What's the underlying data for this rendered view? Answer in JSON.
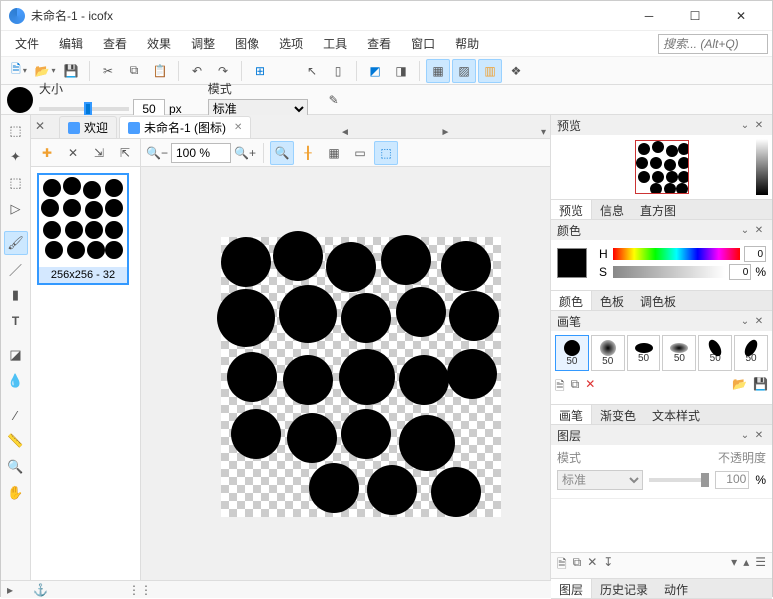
{
  "window": {
    "title": "未命名-1 - icofx"
  },
  "menu": {
    "file": "文件",
    "edit": "编辑",
    "view": "查看",
    "effect": "效果",
    "adjust": "调整",
    "image": "图像",
    "options": "选项",
    "tools": "工具",
    "view2": "查看",
    "window": "窗口",
    "help": "帮助",
    "searchPlaceholder": "搜索... (Alt+Q)"
  },
  "brushbar": {
    "sizeLabel": "大小",
    "sizeVal": "50",
    "sizeUnit": "px",
    "modeLabel": "模式",
    "modeVal": "标准"
  },
  "tabs": {
    "welcome": "欢迎",
    "doc": "未命名-1 (图标)"
  },
  "thumb": {
    "label": "256x256 - 32"
  },
  "canvas": {
    "zoom": "100 %"
  },
  "panels": {
    "preview": "预览",
    "previewTab": "预览",
    "infoTab": "信息",
    "histoTab": "直方图",
    "colors": "颜色",
    "colorsTab": "颜色",
    "paletteTab": "色板",
    "mixerTab": "调色板",
    "hVal": "0",
    "sVal": "0",
    "sUnit": "%",
    "hLab": "H",
    "sLab": "S",
    "brush": "画笔",
    "brushTab": "画笔",
    "gradTab": "渐变色",
    "textTab": "文本样式",
    "layer": "图层",
    "modeLbl": "模式",
    "modeVal": "标准",
    "opLbl": "不透明度",
    "opVal": "100",
    "opUnit": "%",
    "layerTab": "图层",
    "historyTab": "历史记录",
    "actionTab": "动作"
  },
  "brushSizes": [
    "50",
    "50",
    "50",
    "50",
    "50",
    "50"
  ]
}
